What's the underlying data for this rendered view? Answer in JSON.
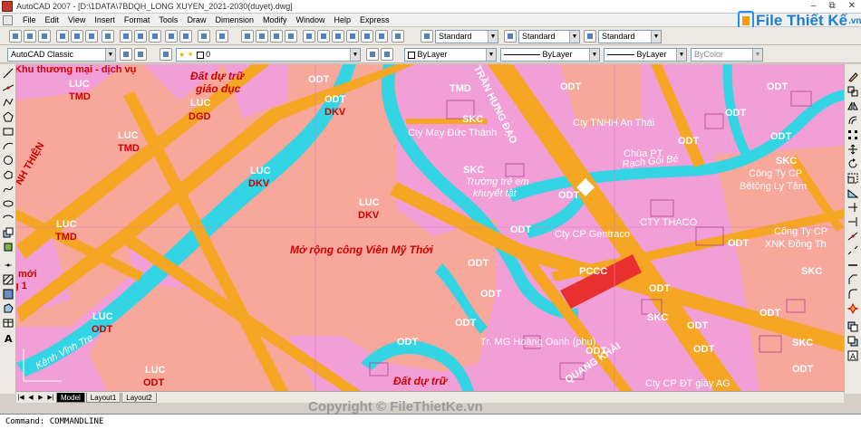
{
  "window": {
    "title": "AutoCAD 2007 - [D:\\1DATA\\7BDQH_LONG XUYEN_2021-2030(duyet).dwg]",
    "controls": [
      "–",
      "⧉",
      "✕"
    ]
  },
  "menu": {
    "items": [
      "File",
      "Edit",
      "View",
      "Insert",
      "Format",
      "Tools",
      "Draw",
      "Dimension",
      "Modify",
      "Window",
      "Help",
      "Express"
    ]
  },
  "styles_toolbar": {
    "text_style": "Standard",
    "dim_style": "Standard",
    "table_style": "Standard"
  },
  "layers_toolbar": {
    "workspace": "AutoCAD Classic",
    "layer": "0",
    "color": "ByLayer",
    "linetype": "ByLayer",
    "lineweight": "ByLayer",
    "plotstyle": "ByColor"
  },
  "brand": {
    "name": "File Thiết Kế",
    "domain": ".vn"
  },
  "map": {
    "labels": [
      {
        "k": "khu",
        "t": "Khu thương mại - dịch vụ"
      },
      {
        "k": "ddt1",
        "t": "Đất dự trữ"
      },
      {
        "k": "gd",
        "t": "giáo dục"
      },
      {
        "k": "luc1",
        "t": "LUC"
      },
      {
        "k": "tmd1",
        "t": "TMD"
      },
      {
        "k": "luc2",
        "t": "LUC"
      },
      {
        "k": "dgd",
        "t": "DGD"
      },
      {
        "k": "odt1",
        "t": "ODT"
      },
      {
        "k": "odt2",
        "t": "ODT"
      },
      {
        "k": "dkv1",
        "t": "DKV"
      },
      {
        "k": "luc3",
        "t": "LUC"
      },
      {
        "k": "tmd2",
        "t": "TMD"
      },
      {
        "k": "luc4",
        "t": "LUC"
      },
      {
        "k": "dkv2",
        "t": "DKV"
      },
      {
        "k": "nhthien",
        "t": "NH THIỆN"
      },
      {
        "k": "luc5",
        "t": "LUC"
      },
      {
        "k": "dkv3",
        "t": "DKV"
      },
      {
        "k": "luc6",
        "t": "LUC"
      },
      {
        "k": "tmd3",
        "t": "TMD"
      },
      {
        "k": "mvt",
        "t": "Mở rộng công Viên Mỹ Thới"
      },
      {
        "k": "moi",
        "t": "mới"
      },
      {
        "k": "g1",
        "t": "g 1"
      },
      {
        "k": "luc7",
        "t": "LUC"
      },
      {
        "k": "odt3",
        "t": "ODT"
      },
      {
        "k": "luc8",
        "t": "LUC"
      },
      {
        "k": "odt4",
        "t": "ODT"
      },
      {
        "k": "ddt2",
        "t": "Đất dự trữ"
      },
      {
        "k": "rachvinhte",
        "t": "Kênh Vĩnh Tre"
      },
      {
        "k": "tmd4",
        "t": "TMD"
      },
      {
        "k": "odt5",
        "t": "ODT"
      },
      {
        "k": "thd",
        "t": "TRẦN HƯNG ĐẠO"
      },
      {
        "k": "ctyan",
        "t": "Cty TNHH An Thái"
      },
      {
        "k": "skc1",
        "t": "SKC"
      },
      {
        "k": "ctymay",
        "t": "Cty May Đức Thành"
      },
      {
        "k": "chua",
        "t": "Chùa PT"
      },
      {
        "k": "rachgoi",
        "t": "Rạch Gòi Bé"
      },
      {
        "k": "skc2",
        "t": "SKC"
      },
      {
        "k": "truong",
        "t": "Trường trẻ em"
      },
      {
        "k": "khuyet",
        "t": "khuyết tật"
      },
      {
        "k": "odt6",
        "t": "ODT"
      },
      {
        "k": "odt7",
        "t": "ODT"
      },
      {
        "k": "odt8",
        "t": "ODT"
      },
      {
        "k": "ctythaco",
        "t": "CTY THACO"
      },
      {
        "k": "ctygen",
        "t": "Cty CP Gentraco"
      },
      {
        "k": "pccc",
        "t": "PCCC"
      },
      {
        "k": "odt9",
        "t": "ODT"
      },
      {
        "k": "odt10",
        "t": "ODT"
      },
      {
        "k": "skc3",
        "t": "SKC"
      },
      {
        "k": "skc4",
        "t": "SKC"
      },
      {
        "k": "ctycp1",
        "t": "Công Ty CP"
      },
      {
        "k": "betong",
        "t": "Bêtông Ly Tâm"
      },
      {
        "k": "ctycp2",
        "t": "Công Ty CP"
      },
      {
        "k": "xnk",
        "t": "XNK Đồng Th"
      },
      {
        "k": "odt11",
        "t": "ODT"
      },
      {
        "k": "odt12",
        "t": "ODT"
      },
      {
        "k": "skc5",
        "t": "SKC"
      },
      {
        "k": "odt13",
        "t": "ODT"
      },
      {
        "k": "odt14",
        "t": "ODT"
      },
      {
        "k": "odt15",
        "t": "ODT"
      },
      {
        "k": "odt16",
        "t": "ODT"
      },
      {
        "k": "skc6",
        "t": "SKC"
      },
      {
        "k": "odt17",
        "t": "ODT"
      },
      {
        "k": "oanh",
        "t": "Tr. MG Hoàng Oanh (phụ)"
      },
      {
        "k": "quangkhai",
        "t": "QUANG KHẢI"
      },
      {
        "k": "ctyag",
        "t": "Cty CP ĐT giày AG"
      },
      {
        "k": "odt18",
        "t": "ODT"
      },
      {
        "k": "odt19",
        "t": "ODT"
      },
      {
        "k": "odt20",
        "t": "ODT"
      },
      {
        "k": "odt21",
        "t": "ODT"
      },
      {
        "k": "odt22",
        "t": "ODT"
      }
    ]
  },
  "layout_tabs": [
    "Model",
    "Layout1",
    "Layout2"
  ],
  "watermark": "Copyright © FileThietKe.vn",
  "command": "Command: COMMANDLINE",
  "colors": {
    "residential": "#f29fd7",
    "rice": "#f8a79b",
    "road": "#f5a623",
    "water": "#33d4e3",
    "fire": "#e8302f"
  }
}
